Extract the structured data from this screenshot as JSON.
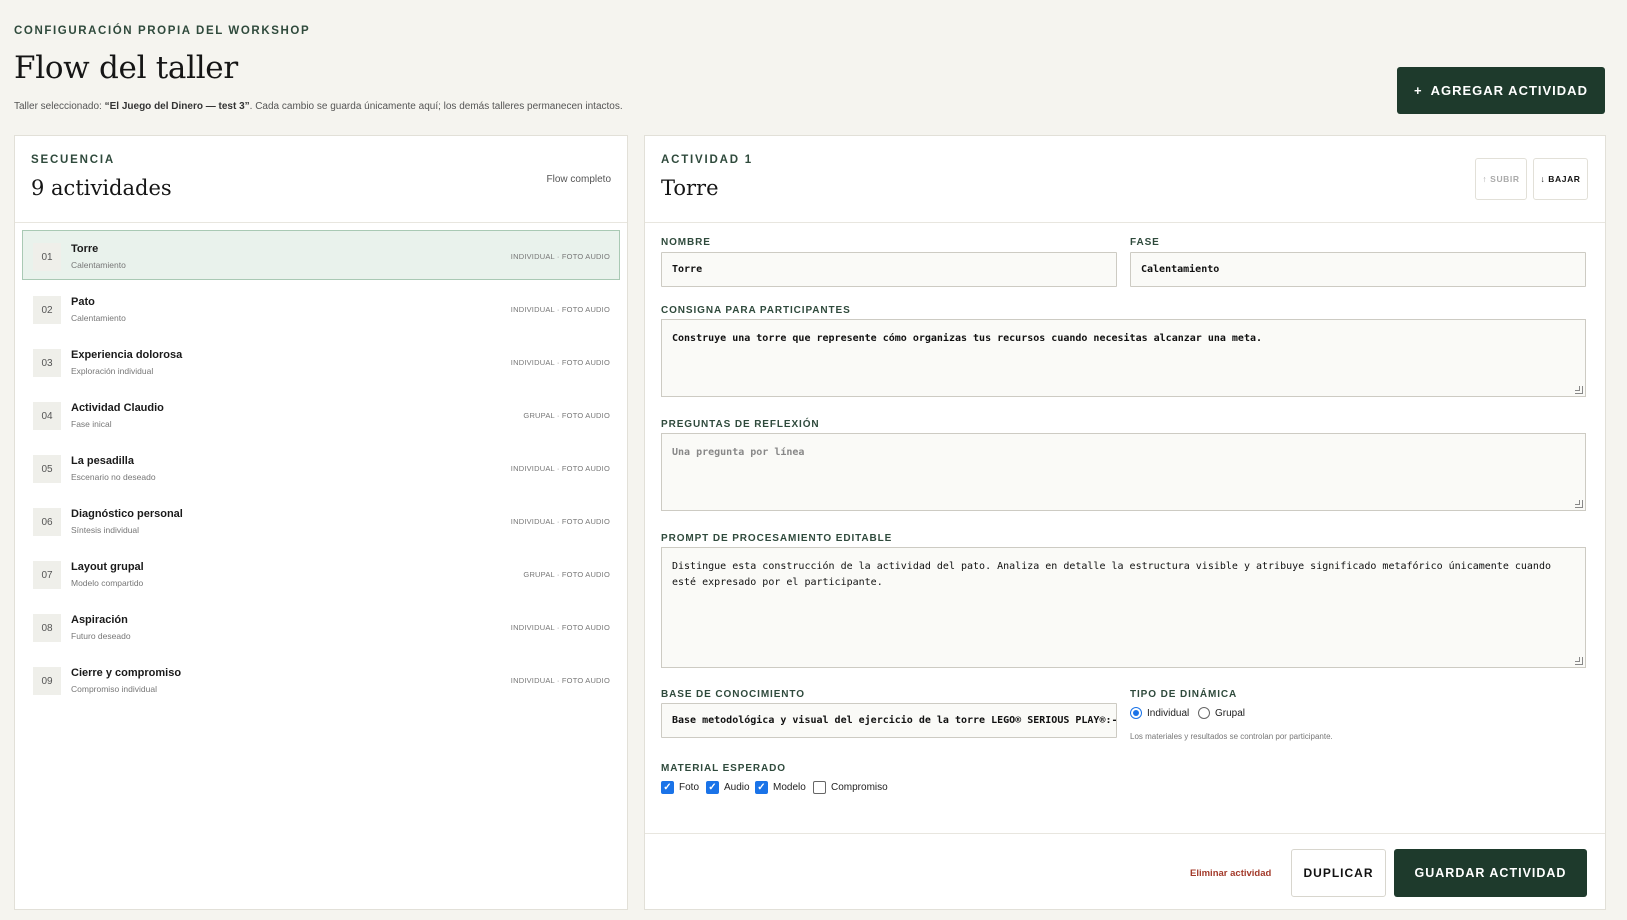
{
  "header": {
    "eyebrow": "CONFIGURACIÓN PROPIA DEL WORKSHOP",
    "title": "Flow del taller",
    "subtitle_prefix": "Taller seleccionado: ",
    "subtitle_workshop": "“El Juego del Dinero — test 3”",
    "subtitle_suffix": ". Cada cambio se guarda únicamente aquí; los demás talleres permanecen intactos.",
    "add_button_icon": "+",
    "add_button_label": "AGREGAR ACTIVIDAD"
  },
  "sequence": {
    "kicker": "SECUENCIA",
    "title": "9 actividades",
    "flow_link": "Flow completo",
    "items": [
      {
        "num": "01",
        "name": "Torre",
        "phase": "Calentamiento",
        "meta": "INDIVIDUAL · FOTO AUDIO",
        "active": true
      },
      {
        "num": "02",
        "name": "Pato",
        "phase": "Calentamiento",
        "meta": "INDIVIDUAL · FOTO AUDIO"
      },
      {
        "num": "03",
        "name": "Experiencia dolorosa",
        "phase": "Exploración individual",
        "meta": "INDIVIDUAL · FOTO AUDIO"
      },
      {
        "num": "04",
        "name": "Actividad Claudio",
        "phase": "Fase inical",
        "meta": "GRUPAL · FOTO AUDIO"
      },
      {
        "num": "05",
        "name": "La pesadilla",
        "phase": "Escenario no deseado",
        "meta": "INDIVIDUAL · FOTO AUDIO"
      },
      {
        "num": "06",
        "name": "Diagnóstico personal",
        "phase": "Síntesis individual",
        "meta": "INDIVIDUAL · FOTO AUDIO"
      },
      {
        "num": "07",
        "name": "Layout grupal",
        "phase": "Modelo compartido",
        "meta": "GRUPAL · FOTO AUDIO"
      },
      {
        "num": "08",
        "name": "Aspiración",
        "phase": "Futuro deseado",
        "meta": "INDIVIDUAL · FOTO AUDIO"
      },
      {
        "num": "09",
        "name": "Cierre y compromiso",
        "phase": "Compromiso individual",
        "meta": "INDIVIDUAL · FOTO AUDIO"
      }
    ]
  },
  "editor": {
    "kicker": "ACTIVIDAD 1",
    "title": "Torre",
    "up_label": "↑ SUBIR",
    "down_label": "↓ BAJAR",
    "name_label": "NOMBRE",
    "name_value": "Torre",
    "phase_label": "FASE",
    "phase_value": "Calentamiento",
    "instruction_label": "CONSIGNA PARA PARTICIPANTES",
    "instruction_value": "Construye una torre que represente cómo organizas tus recursos cuando necesitas alcanzar una meta.",
    "questions_label": "PREGUNTAS DE REFLEXIÓN",
    "questions_placeholder": "Una pregunta por línea",
    "prompt_label": "PROMPT DE PROCESAMIENTO EDITABLE",
    "prompt_value": "Distingue esta construcción de la actividad del pato. Analiza en detalle la estructura visible y atribuye significado metafórico únicamente cuando esté expresado por el participante.",
    "knowledge_label": "BASE DE CONOCIMIENTO",
    "knowledge_value": "Base metodológica y visual del ejercicio de la torre LEGO® SERIOUS PLAY®:- Es",
    "dynamic_label": "TIPO DE DINÁMICA",
    "dynamic_options": [
      "Individual",
      "Grupal"
    ],
    "dynamic_selected": "Individual",
    "dynamic_hint": "Los materiales y resultados se controlan por participante.",
    "material_label": "MATERIAL ESPERADO",
    "materials": [
      {
        "label": "Foto",
        "checked": true
      },
      {
        "label": "Audio",
        "checked": true
      },
      {
        "label": "Modelo",
        "checked": true
      },
      {
        "label": "Compromiso",
        "checked": false
      }
    ],
    "delete_label": "Eliminar actividad",
    "duplicate_label": "DUPLICAR",
    "save_label": "GUARDAR ACTIVIDAD"
  },
  "colors": {
    "accent": "#1e3a2c",
    "kicker": "#2f4a3c",
    "active_row": "#e9f2ec",
    "danger": "#a33a2a",
    "control_blue": "#1a73e8"
  }
}
